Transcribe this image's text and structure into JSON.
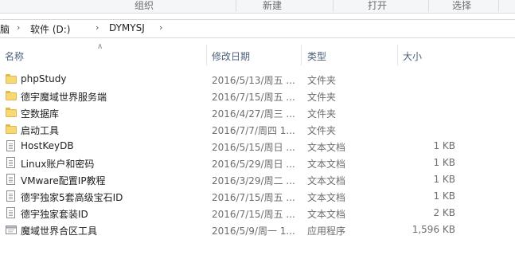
{
  "ribbon": {
    "groups": [
      "组织",
      "新建",
      "打开",
      "选择"
    ]
  },
  "address": {
    "crumbs": [
      "脑",
      "软件 (D:)",
      "DYMYSJ"
    ]
  },
  "columns": {
    "name": "名称",
    "date": "修改日期",
    "type": "类型",
    "size": "大小"
  },
  "files": [
    {
      "name": "phpStudy",
      "date": "2016/5/13/周五 ...",
      "type": "文件夹",
      "size": "",
      "icon": "folder-icon"
    },
    {
      "name": "德宇魔域世界服务端",
      "date": "2016/7/15/周五 ...",
      "type": "文件夹",
      "size": "",
      "icon": "folder-icon"
    },
    {
      "name": "空数据库",
      "date": "2016/4/27/周三 ...",
      "type": "文件夹",
      "size": "",
      "icon": "folder-icon"
    },
    {
      "name": "启动工具",
      "date": "2016/7/7/周四 1...",
      "type": "文件夹",
      "size": "",
      "icon": "folder-icon"
    },
    {
      "name": "HostKeyDB",
      "date": "2016/5/15/周日 ...",
      "type": "文本文档",
      "size": "1 KB",
      "icon": "text-document-icon"
    },
    {
      "name": "Linux账户和密码",
      "date": "2016/5/29/周日 ...",
      "type": "文本文档",
      "size": "1 KB",
      "icon": "text-document-icon"
    },
    {
      "name": "VMware配置IP教程",
      "date": "2016/3/29/周二 ...",
      "type": "文本文档",
      "size": "1 KB",
      "icon": "text-document-icon"
    },
    {
      "name": "德宇独家5套高级宝石ID",
      "date": "2016/7/15/周五 ...",
      "type": "文本文档",
      "size": "1 KB",
      "icon": "text-document-icon"
    },
    {
      "name": "德宇独家套装ID",
      "date": "2016/7/15/周五 ...",
      "type": "文本文档",
      "size": "2 KB",
      "icon": "text-document-icon"
    },
    {
      "name": "魔域世界合区工具",
      "date": "2016/5/9/周一 1...",
      "type": "应用程序",
      "size": "1,596 KB",
      "icon": "application-icon"
    }
  ]
}
